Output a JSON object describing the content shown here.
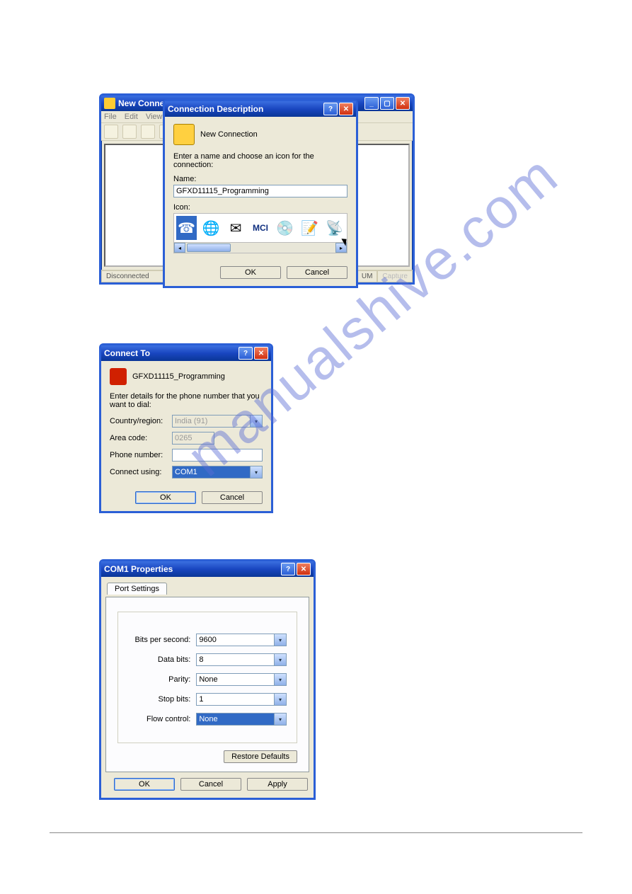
{
  "watermark": "manualshive.com",
  "dialog1": {
    "parent_title": "New Connec",
    "menus": [
      "File",
      "Edit",
      "View"
    ],
    "status_left": "Disconnected",
    "status_right1": "UM",
    "status_right2": "Capture",
    "title": "Connection Description",
    "header": "New Connection",
    "instruction": "Enter a name and choose an icon for the connection:",
    "name_label": "Name:",
    "name_value": "GFXD11115_Programming",
    "icon_label": "Icon:",
    "ok": "OK",
    "cancel": "Cancel"
  },
  "dialog2": {
    "title": "Connect To",
    "header": "GFXD11115_Programming",
    "instruction": "Enter details for the phone number that you want to dial:",
    "country_label": "Country/region:",
    "country_value": "India (91)",
    "area_label": "Area code:",
    "area_value": "0265",
    "phone_label": "Phone number:",
    "phone_value": "",
    "connect_label": "Connect using:",
    "connect_value": "COM1",
    "ok": "OK",
    "cancel": "Cancel"
  },
  "dialog3": {
    "title": "COM1 Properties",
    "tab": "Port Settings",
    "bps_label": "Bits per second:",
    "bps_value": "9600",
    "databits_label": "Data bits:",
    "databits_value": "8",
    "parity_label": "Parity:",
    "parity_value": "None",
    "stopbits_label": "Stop bits:",
    "stopbits_value": "1",
    "flow_label": "Flow control:",
    "flow_value": "None",
    "restore": "Restore Defaults",
    "ok": "OK",
    "cancel": "Cancel",
    "apply": "Apply"
  }
}
